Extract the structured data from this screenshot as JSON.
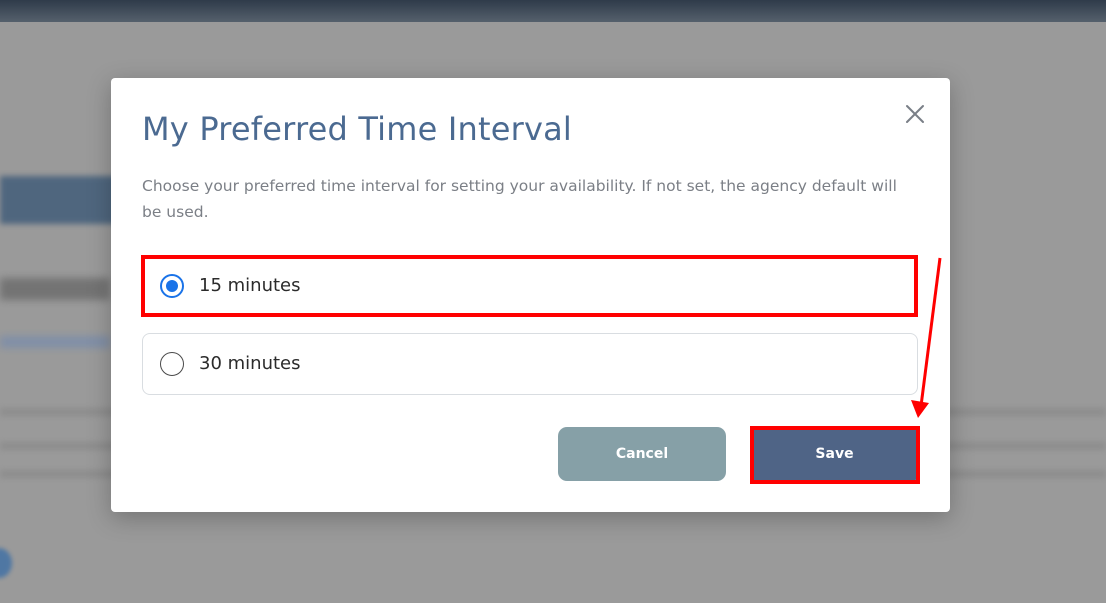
{
  "modal": {
    "title": "My Preferred Time Interval",
    "description": "Choose your preferred time interval for setting your availability. If not set, the agency default will be used.",
    "close_icon": "close-icon",
    "options": [
      {
        "label": "15 minutes",
        "selected": true
      },
      {
        "label": "30 minutes",
        "selected": false
      }
    ],
    "buttons": {
      "cancel_label": "Cancel",
      "save_label": "Save"
    }
  },
  "colors": {
    "title": "#4b6a91",
    "radio_selected": "#1a73e8",
    "cancel_button": "#86a0a7",
    "save_button": "#4f6486",
    "annotation": "#ff0000",
    "overlay": "#9a9a9a"
  }
}
